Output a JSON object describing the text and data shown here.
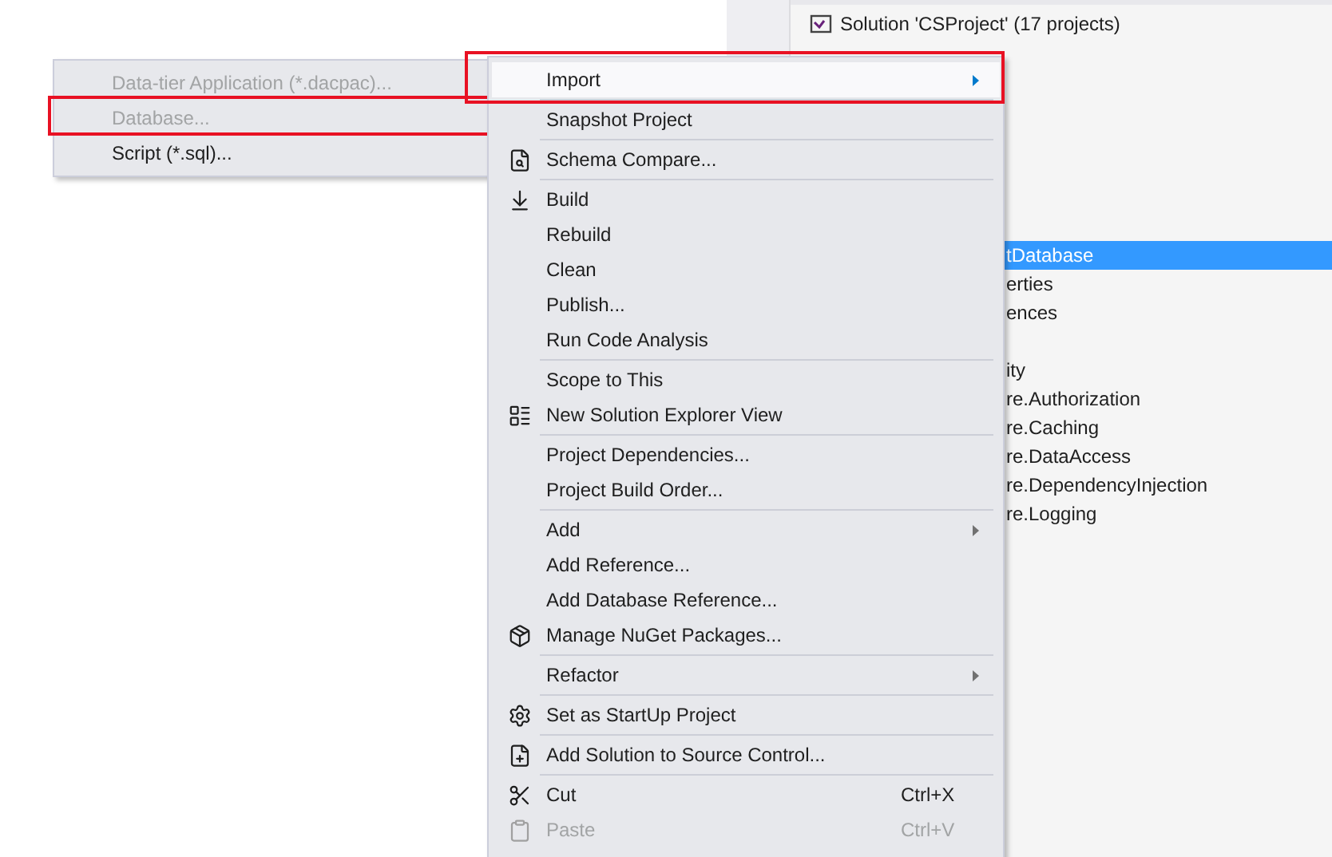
{
  "solution_explorer": {
    "title": "Solution 'CSProject' (17 projects)",
    "rows": [
      {
        "label": "tDatabase",
        "selected": true
      },
      {
        "label": "erties",
        "selected": false
      },
      {
        "label": "ences",
        "selected": false
      },
      {
        "label": "",
        "selected": false
      },
      {
        "label": "ity",
        "selected": false
      },
      {
        "label": "re.Authorization",
        "selected": false
      },
      {
        "label": "re.Caching",
        "selected": false
      },
      {
        "label": "re.DataAccess",
        "selected": false
      },
      {
        "label": "re.DependencyInjection",
        "selected": false
      },
      {
        "label": "re.Logging",
        "selected": false
      }
    ]
  },
  "context_menu": {
    "items": [
      {
        "kind": "item",
        "label": "Import",
        "submenu": true,
        "hovered": true,
        "highlighted": true
      },
      {
        "kind": "separator"
      },
      {
        "kind": "item",
        "label": "Snapshot Project"
      },
      {
        "kind": "separator"
      },
      {
        "kind": "item",
        "label": "Schema Compare..."
      },
      {
        "kind": "separator"
      },
      {
        "kind": "item",
        "label": "Build"
      },
      {
        "kind": "item",
        "label": "Rebuild"
      },
      {
        "kind": "item",
        "label": "Clean"
      },
      {
        "kind": "item",
        "label": "Publish..."
      },
      {
        "kind": "item",
        "label": "Run Code Analysis"
      },
      {
        "kind": "separator"
      },
      {
        "kind": "item",
        "label": "Scope to This"
      },
      {
        "kind": "item",
        "label": "New Solution Explorer View"
      },
      {
        "kind": "separator"
      },
      {
        "kind": "item",
        "label": "Project Dependencies..."
      },
      {
        "kind": "item",
        "label": "Project Build Order..."
      },
      {
        "kind": "separator"
      },
      {
        "kind": "item",
        "label": "Add",
        "submenu": true
      },
      {
        "kind": "item",
        "label": "Add Reference..."
      },
      {
        "kind": "item",
        "label": "Add Database Reference..."
      },
      {
        "kind": "item",
        "label": "Manage NuGet Packages..."
      },
      {
        "kind": "separator"
      },
      {
        "kind": "item",
        "label": "Refactor",
        "submenu": true
      },
      {
        "kind": "separator"
      },
      {
        "kind": "item",
        "label": "Set as StartUp Project"
      },
      {
        "kind": "separator"
      },
      {
        "kind": "item",
        "label": "Add Solution to Source Control..."
      },
      {
        "kind": "separator"
      },
      {
        "kind": "item",
        "label": "Cut",
        "shortcut": "Ctrl+X"
      },
      {
        "kind": "item",
        "label": "Paste",
        "shortcut": "Ctrl+V",
        "disabled": true
      }
    ]
  },
  "import_submenu": {
    "items": [
      {
        "label": "Data-tier Application (*.dacpac)...",
        "disabled": true,
        "highlighted": false
      },
      {
        "label": "Database...",
        "disabled": true,
        "highlighted": true
      },
      {
        "label": "Script (*.sql)...",
        "disabled": false,
        "highlighted": false
      }
    ]
  }
}
